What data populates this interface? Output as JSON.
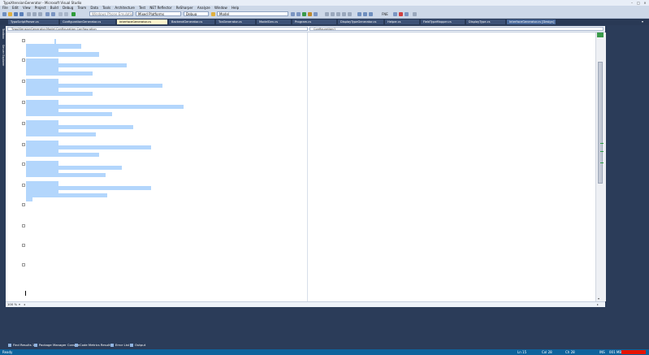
{
  "window": {
    "title": "TypoXtensionGenerator - Microsoft Visual Studio"
  },
  "menu": [
    "File",
    "Edit",
    "View",
    "Project",
    "Build",
    "Debug",
    "Team",
    "Data",
    "Tools",
    "Architecture",
    "Test",
    "NET Reflector",
    "ReSharper",
    "Analyze",
    "Window",
    "Help"
  ],
  "toolbar": {
    "platform_combo": "Windows Phone Emulation",
    "solution_platform": "Mixed Platforms",
    "config_combo": "Debug",
    "find_combo": "Model",
    "fne_label": "FNE"
  },
  "tabs": [
    {
      "label": "TypoScriptParser.cs",
      "active": false
    },
    {
      "label": "ConfigurationGenerator.cs",
      "active": false
    },
    {
      "label": "InterfaceGenerator.cs",
      "active": true
    },
    {
      "label": "BackendGenerator.cs",
      "active": false
    },
    {
      "label": "TcaGenerator.cs",
      "active": false
    },
    {
      "label": "ModelGen.cs",
      "active": false
    },
    {
      "label": "Program.cs",
      "active": false
    },
    {
      "label": "DisplayTypeGenerator.cs",
      "active": false
    },
    {
      "label": "Helper.cs",
      "active": false
    },
    {
      "label": "FieldTypeMapper.cs",
      "active": false
    },
    {
      "label": "DisplayType.cs",
      "active": false
    },
    {
      "label": "InterfaceGenerator.cs [Design]",
      "active": false
    }
  ],
  "sidebar": {
    "items": [
      "Toolbox",
      "Server Explorer"
    ]
  },
  "navbar": {
    "type_combo": "TypoXtensionGenerator.Model.Configuration.Configuration",
    "member_combo": "Configuration()"
  },
  "editor": {
    "zoom": "100 %"
  },
  "toolwindows": [
    "Find Results 1",
    "Package Manager Console",
    "Code Metrics Results",
    "Error List",
    "Output"
  ],
  "status": {
    "left": "Ready",
    "ln": "Ln 15",
    "col": "Col 28",
    "ch": "Ch 28",
    "ins": "INS",
    "extra": "001 MB",
    "accent": "#e51400"
  }
}
